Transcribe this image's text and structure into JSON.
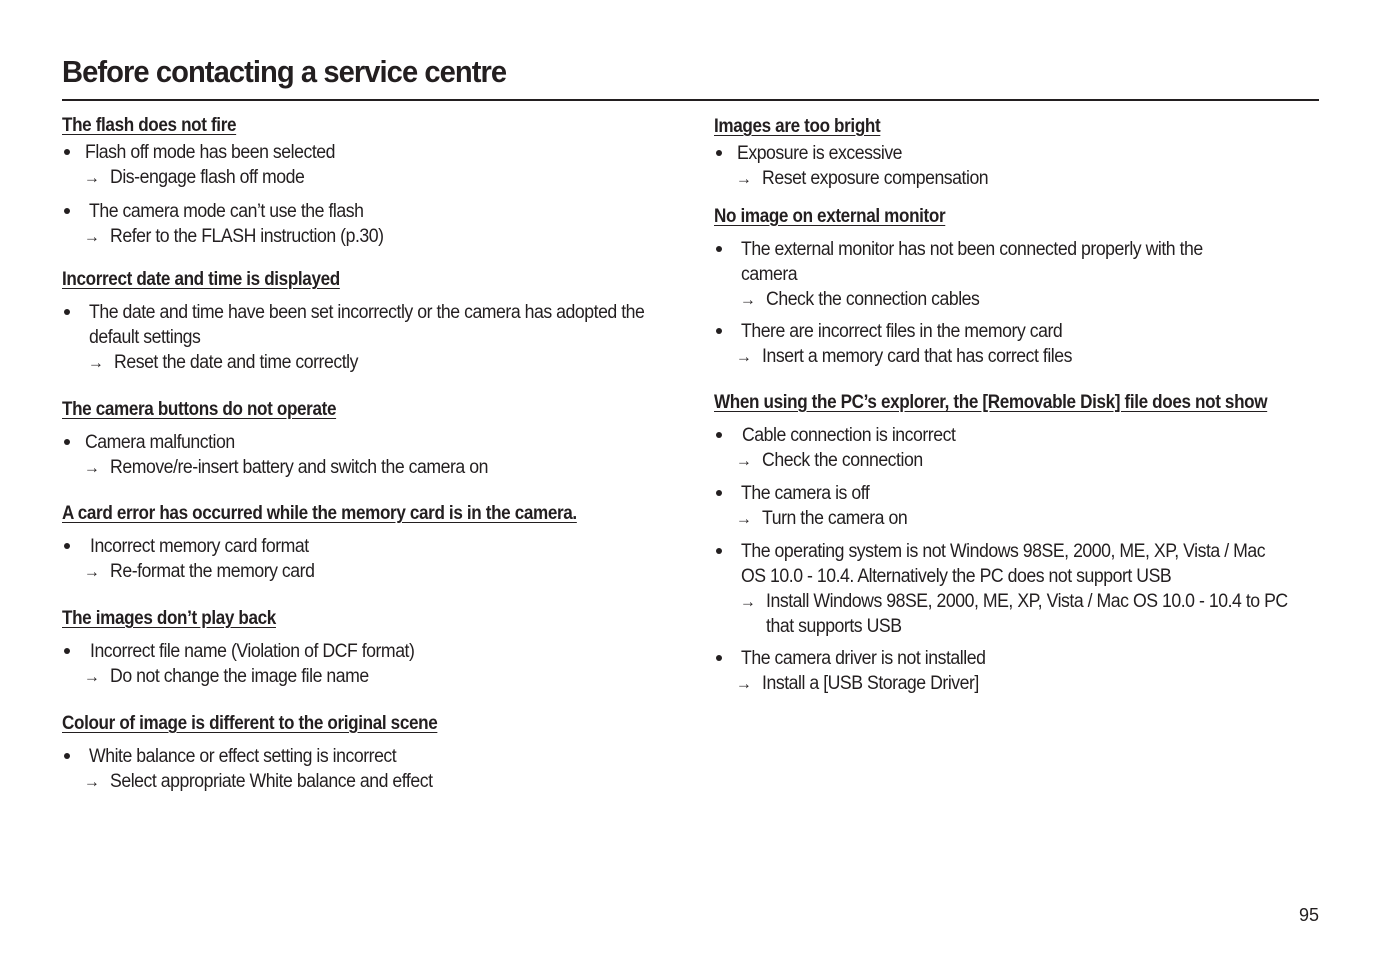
{
  "page": {
    "title": "Before contacting a service centre",
    "page_number": "95",
    "arrow_glyph": "→"
  },
  "left": [
    {
      "heading": "The flash does not fire",
      "items": [
        {
          "cause": "Flash off mode has been selected",
          "remedy": "Dis-engage flash off mode"
        },
        {
          "cause": "The camera mode can’t use the flash",
          "remedy": "Refer to the FLASH instruction (p.30)"
        }
      ]
    },
    {
      "heading": "Incorrect date and time is displayed",
      "items": [
        {
          "cause": "The date and time have been set incorrectly or the camera has adopted the default settings",
          "remedy": "Reset the date and time correctly"
        }
      ]
    },
    {
      "heading": "The camera buttons do not operate",
      "items": [
        {
          "cause": "Camera malfunction",
          "remedy": "Remove/re-insert battery and switch the camera on"
        }
      ]
    },
    {
      "heading": "A card error has occurred while the memory card is in the camera.",
      "items": [
        {
          "cause": "Incorrect memory card format",
          "remedy": "Re-format the memory card"
        }
      ]
    },
    {
      "heading": "The images don’t play back",
      "items": [
        {
          "cause": "Incorrect file name (Violation of DCF format)",
          "remedy": "Do not change the image file name"
        }
      ]
    },
    {
      "heading": "Colour of image is different to the original scene",
      "items": [
        {
          "cause": "White balance or effect setting is incorrect",
          "remedy": "Select appropriate White balance and effect"
        }
      ]
    }
  ],
  "right": [
    {
      "heading": "Images are too bright",
      "items": [
        {
          "cause": "Exposure is excessive",
          "remedy": "Reset exposure compensation"
        }
      ]
    },
    {
      "heading": "No image on external monitor",
      "items": [
        {
          "cause": "The external monitor has not been connected properly with the camera",
          "remedy": "Check the connection cables"
        },
        {
          "cause": "There are incorrect files in the memory card",
          "remedy": "Insert a memory card that has correct files"
        }
      ]
    },
    {
      "heading": "When using the PC’s explorer, the [Removable Disk] file does not show",
      "items": [
        {
          "cause": "Cable connection is incorrect",
          "remedy": "Check the connection"
        },
        {
          "cause": "The camera is off",
          "remedy": "Turn the camera on"
        },
        {
          "cause": "The operating system is not Windows 98SE, 2000, ME, XP, Vista / Mac OS 10.0 - 10.4. Alternatively the PC does not support USB",
          "remedy": "Install Windows 98SE, 2000, ME, XP, Vista / Mac OS 10.0 - 10.4 to PC that supports USB"
        },
        {
          "cause": "The camera driver is not installed",
          "remedy": "Install a [USB Storage Driver]"
        }
      ]
    }
  ]
}
